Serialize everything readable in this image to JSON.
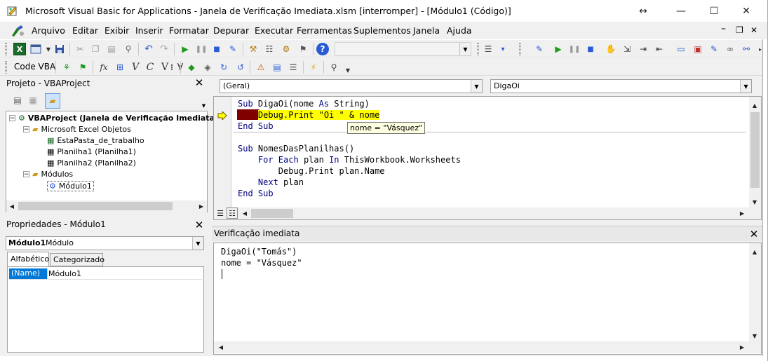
{
  "window": {
    "title": "Microsoft Visual Basic for Applications - Janela de Verificação Imediata.xlsm [interromper] - [Módulo1 (Código)]",
    "controls": {
      "minimize": "—",
      "maximize": "☐",
      "close": "✕",
      "resize": "↔"
    }
  },
  "menu": {
    "items": [
      "Arquivo",
      "Editar",
      "Exibir",
      "Inserir",
      "Formatar",
      "Depurar",
      "Executar",
      "Ferramentas",
      "Suplementos",
      "Janela",
      "Ajuda"
    ],
    "mdi": {
      "minimize": "–",
      "restore": "❐",
      "close": "✕"
    }
  },
  "toolbar3": {
    "label": "Code VBA"
  },
  "project": {
    "title": "Projeto - VBAProject",
    "root": "VBAProject (Janela de Verificação Imediata",
    "folder1": "Microsoft Excel Objetos",
    "item1": "EstaPasta_de_trabalho",
    "item2": "Planilha1 (Planilha1)",
    "item3": "Planilha2 (Planilha2)",
    "folder2": "Módulos",
    "item4": "Módulo1"
  },
  "properties": {
    "title": "Propriedades - Módulo1",
    "object_name": "Módulo1",
    "object_type": "Módulo",
    "tab_alpha": "Alfabético",
    "tab_cat": "Categorizado",
    "prop_name": "(Name)",
    "prop_value": "Módulo1"
  },
  "editor": {
    "combo_left": "(Geral)",
    "combo_right": "DigaOi",
    "tooltip": "nome = \"Vásquez\"",
    "lines": [
      {
        "kw1": "Sub ",
        "txt": "DigaOi(nome ",
        "kw2": "As ",
        "txt2": "String)"
      },
      {
        "indent": "    ",
        "hl": "Debug.Print \"Oi \" & nome"
      },
      {
        "kw1": "End Sub"
      },
      {
        "kw1": "Sub ",
        "txt": "NomesDasPlanilhas()"
      },
      {
        "indent": "    ",
        "kw1": "For Each ",
        "txt": "plan ",
        "kw2": "In ",
        "txt2": "ThisWorkbook.Worksheets"
      },
      {
        "indent": "        ",
        "txt": "Debug.Print plan.Name"
      },
      {
        "indent": "    ",
        "kw1": "Next ",
        "txt": "plan"
      },
      {
        "kw1": "End Sub"
      }
    ]
  },
  "immediate": {
    "title": "Verificação imediata",
    "line1": "DigaOi(\"Tomás\")",
    "line2": "nome = \"Vásquez\""
  },
  "colors": {
    "highlight": "#ffff00",
    "breakpoint": "#800000",
    "keyword": "#00007f",
    "selection": "#0078d7"
  }
}
